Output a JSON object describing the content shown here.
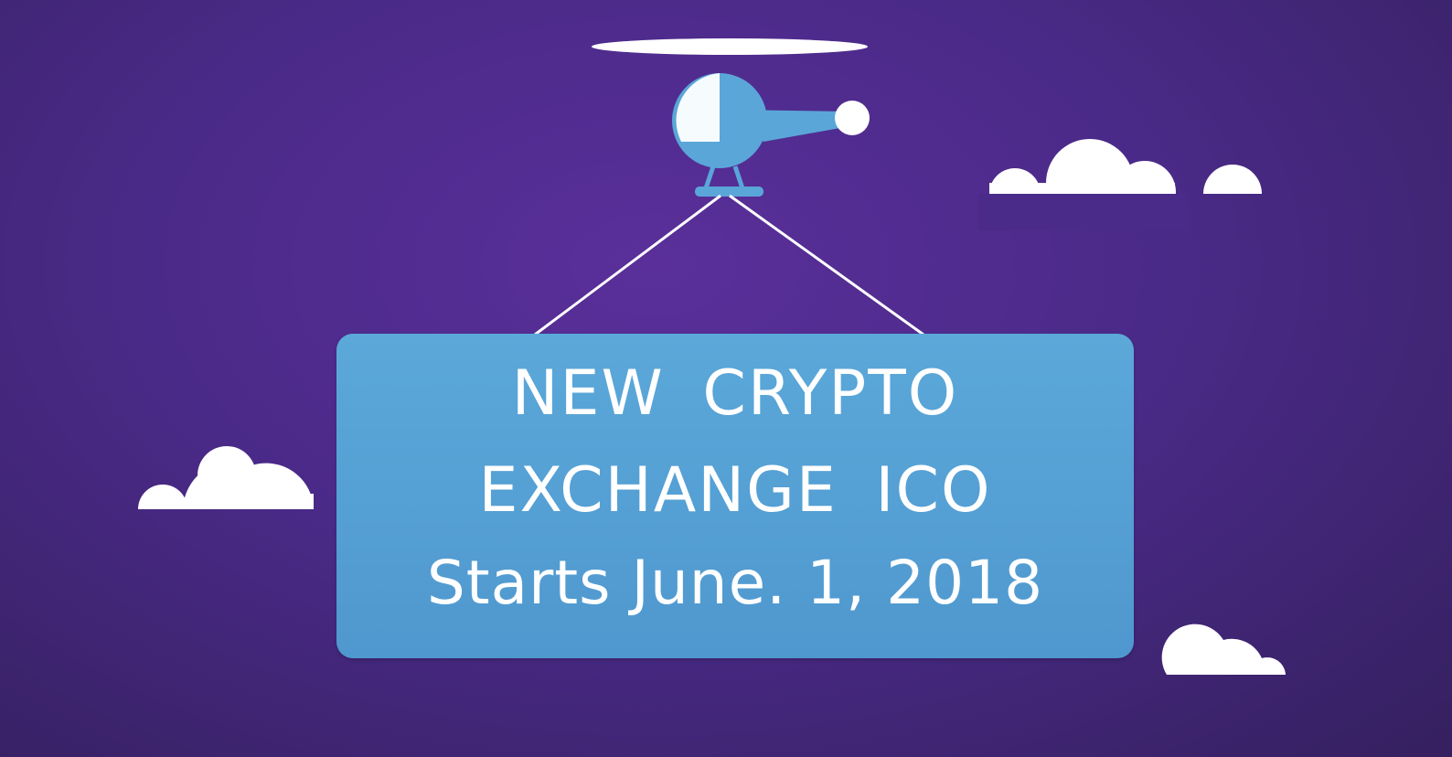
{
  "sign": {
    "line1": "NEW  CRYPTO",
    "line2": "EXCHANGE  ICO",
    "line3": "Starts June. 1, 2018"
  },
  "colors": {
    "background": "#4a2a88",
    "sign": "#5ba8d9",
    "helicopter": "#5aa6d8",
    "cloud": "#ffffff",
    "text": "#ffffff"
  },
  "icons": {
    "helicopter": "helicopter-icon",
    "cloud": "cloud-icon"
  }
}
